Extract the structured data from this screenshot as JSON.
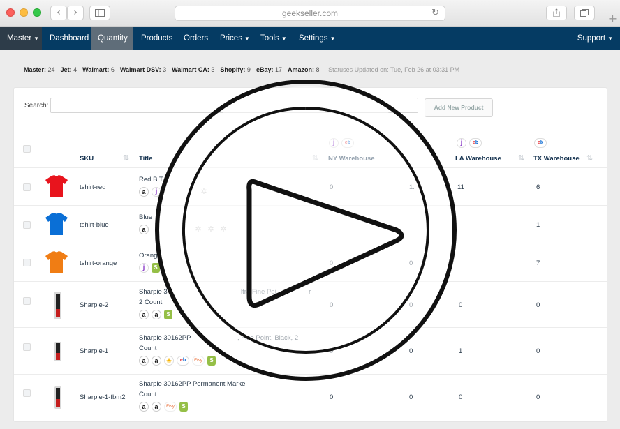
{
  "browser": {
    "url": "geekseller.com",
    "back_icon": "chevron-left-icon",
    "forward_icon": "chevron-right-icon"
  },
  "nav": {
    "master": "Master",
    "items": [
      "Dashboard",
      "Quantity",
      "Products",
      "Orders",
      "Prices",
      "Tools",
      "Settings"
    ],
    "support": "Support"
  },
  "status": {
    "counts": [
      {
        "label": "Master:",
        "value": "24"
      },
      {
        "label": "Jet:",
        "value": "4"
      },
      {
        "label": "Walmart:",
        "value": "6"
      },
      {
        "label": "Walmart DSV:",
        "value": "3"
      },
      {
        "label": "Walmart CA:",
        "value": "3"
      },
      {
        "label": "Shopify:",
        "value": "9"
      },
      {
        "label": "eBay:",
        "value": "17"
      },
      {
        "label": "Amazon:",
        "value": "8"
      }
    ],
    "updated": "Statuses Updated on: Tue, Feb 26 at 03:31 PM"
  },
  "search": {
    "label": "Search:",
    "value": "",
    "add_button": "Add New Product"
  },
  "table": {
    "headers": {
      "sku": "SKU",
      "title": "Title",
      "ny": "NY Warehouse",
      "la": "LA Warehouse",
      "tx": "TX Warehouse"
    },
    "rows": [
      {
        "sku": "tshirt-red",
        "title1": "Red B T",
        "title2": "",
        "ny": "0",
        "mid": "1.",
        "la": "11",
        "tx": "6"
      },
      {
        "sku": "tshirt-blue",
        "title1": "Blue",
        "title2": "",
        "ny": "",
        "mid": "",
        "la": "",
        "tx": "1"
      },
      {
        "sku": "tshirt-orange",
        "title1": "Orang",
        "title2": "",
        "ny": "0",
        "mid": "0",
        "la": "",
        "tx": "7"
      },
      {
        "sku": "Sharpie-2",
        "title1": "Sharpie 3",
        "title1b": "ltra Fine Poi",
        "title1c": "r",
        "title2": "2 Count",
        "ny": "0",
        "mid": "0",
        "la": "0",
        "tx": "0"
      },
      {
        "sku": "Sharpie-1",
        "title1": "Sharpie 30162PP",
        "title1b": ", Fine Point, Black, 2",
        "title2": "Count",
        "ny": "0",
        "mid": "0",
        "la": "1",
        "tx": "0"
      },
      {
        "sku": "Sharpie-1-fbm2",
        "title1": "Sharpie 30162PP Permanent Marke",
        "title2": "Count",
        "ny": "0",
        "mid": "0",
        "la": "0",
        "tx": "0"
      }
    ]
  },
  "badge_text": {
    "amazon": "a",
    "walmart": "✳",
    "jet": "j",
    "ebay": "eb",
    "etsy": "Etsy",
    "shopify": "S",
    "loading": "✲"
  },
  "colors": {
    "nav_bg": "#053b63",
    "nav_active": "#5f6d79",
    "shirt_red": "#e8141d",
    "shirt_blue": "#0a6fd6",
    "shirt_orange": "#f07d14"
  }
}
